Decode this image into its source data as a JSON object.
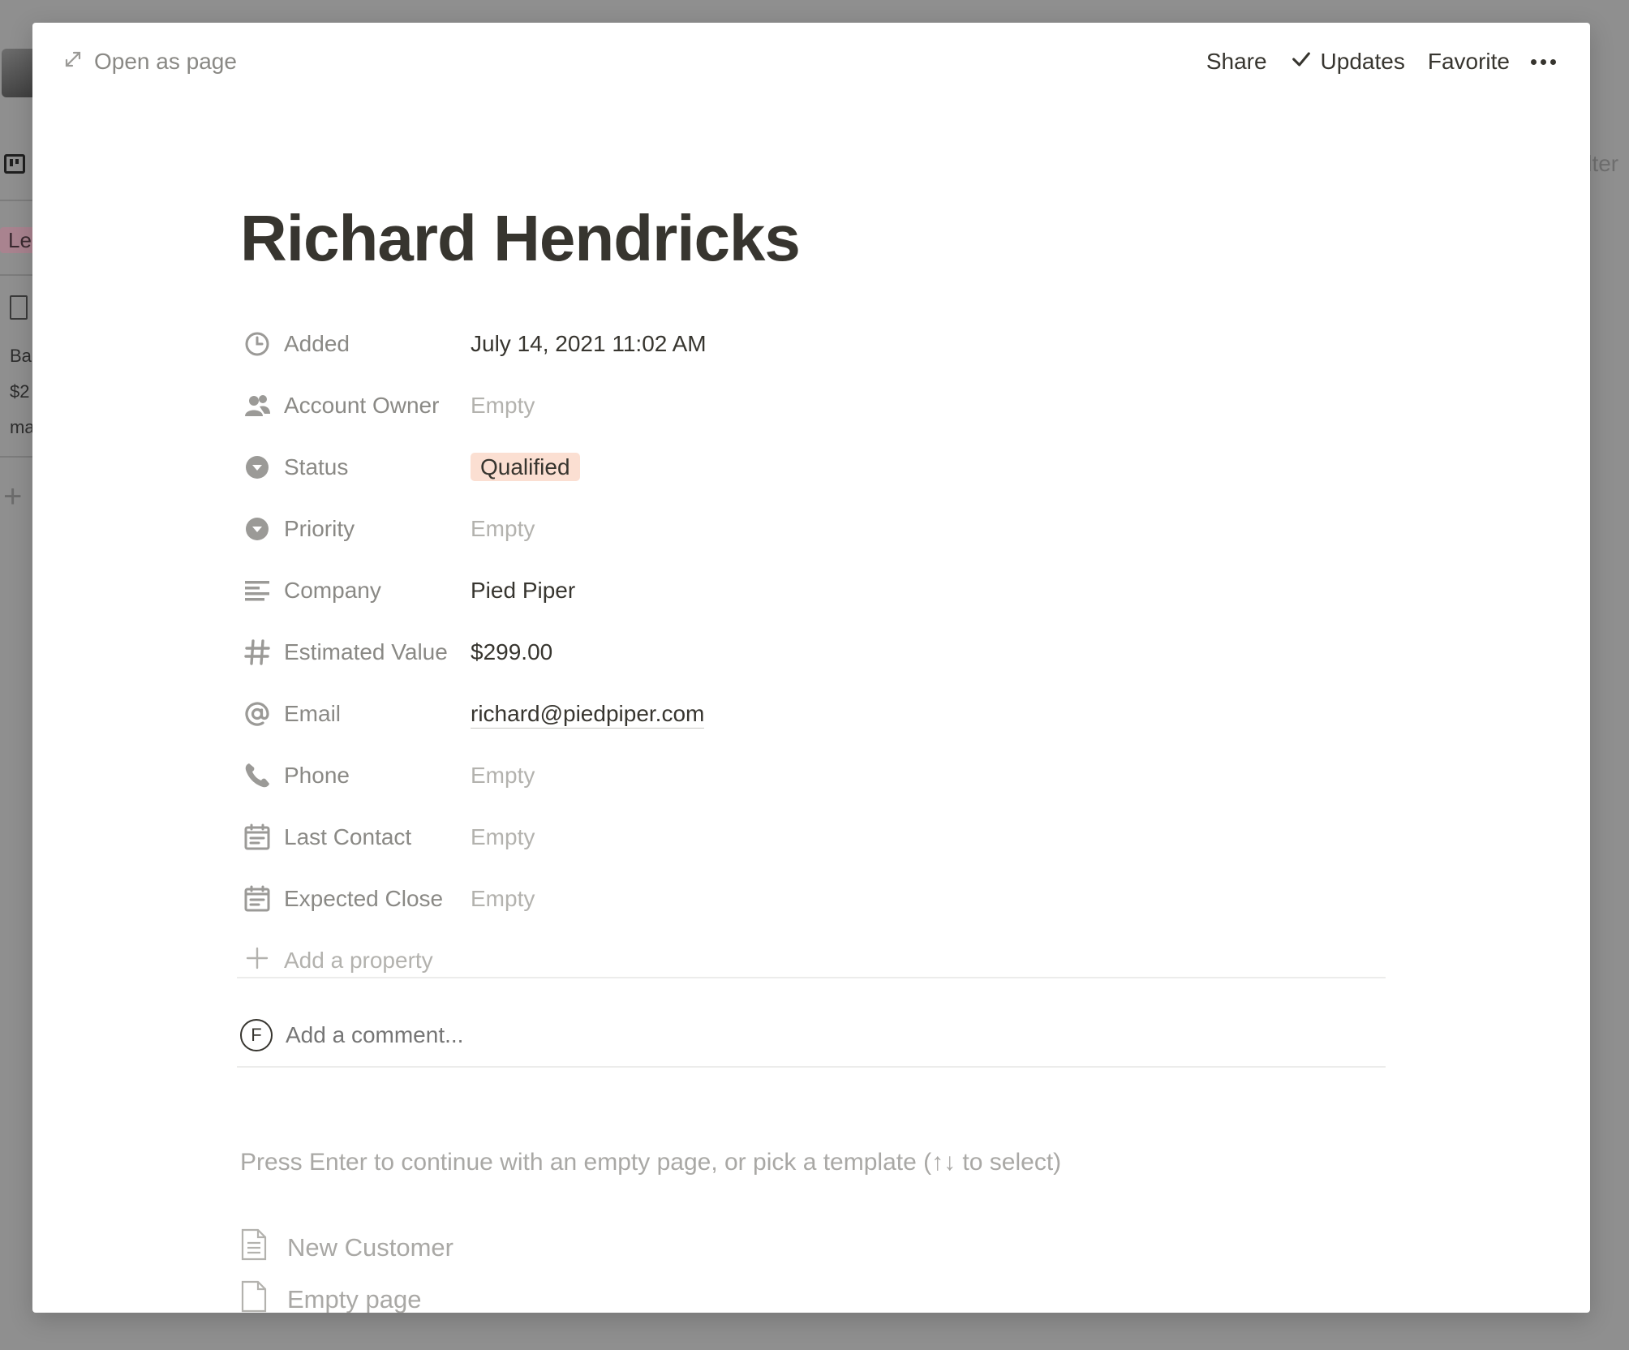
{
  "background": {
    "tag_text": "Le",
    "card_lines": [
      "Ba",
      "$2",
      "ma"
    ],
    "right_text": "ilter"
  },
  "topbar": {
    "open_as_page": "Open as page",
    "share": "Share",
    "updates": "Updates",
    "favorite": "Favorite"
  },
  "page": {
    "title": "Richard Hendricks"
  },
  "properties": [
    {
      "icon": "clock-icon",
      "label": "Added",
      "value": "July 14, 2021 11:02 AM",
      "empty": false
    },
    {
      "icon": "person-icon",
      "label": "Account Owner",
      "value": "Empty",
      "empty": true
    },
    {
      "icon": "select-icon",
      "label": "Status",
      "value": "Qualified",
      "tag_color": "#fbdfd2"
    },
    {
      "icon": "select-icon",
      "label": "Priority",
      "value": "Empty",
      "empty": true
    },
    {
      "icon": "text-icon",
      "label": "Company",
      "value": "Pied Piper",
      "empty": false
    },
    {
      "icon": "number-icon",
      "label": "Estimated Value",
      "value": "$299.00",
      "empty": false
    },
    {
      "icon": "at-icon",
      "label": "Email",
      "value": "richard@piedpiper.com",
      "empty": false
    },
    {
      "icon": "phone-icon",
      "label": "Phone",
      "value": "Empty",
      "empty": true
    },
    {
      "icon": "calendar-icon",
      "label": "Last Contact",
      "value": "Empty",
      "empty": true
    },
    {
      "icon": "calendar-icon",
      "label": "Expected Close",
      "value": "Empty",
      "empty": true
    }
  ],
  "add_property": "Add a property",
  "comment": {
    "avatar_initial": "F",
    "placeholder": "Add a comment..."
  },
  "hint": "Press Enter to continue with an empty page, or pick a template (↑↓ to select)",
  "templates": [
    {
      "icon": "document-lines-icon",
      "label": "New Customer"
    },
    {
      "icon": "document-icon",
      "label": "Empty page"
    }
  ],
  "colors": {
    "overlay": "#8f8f8f",
    "text": "#37352f",
    "muted": "#8a8985",
    "placeholder": "#b3b2ae",
    "status_tag": "#fbdfd2"
  }
}
